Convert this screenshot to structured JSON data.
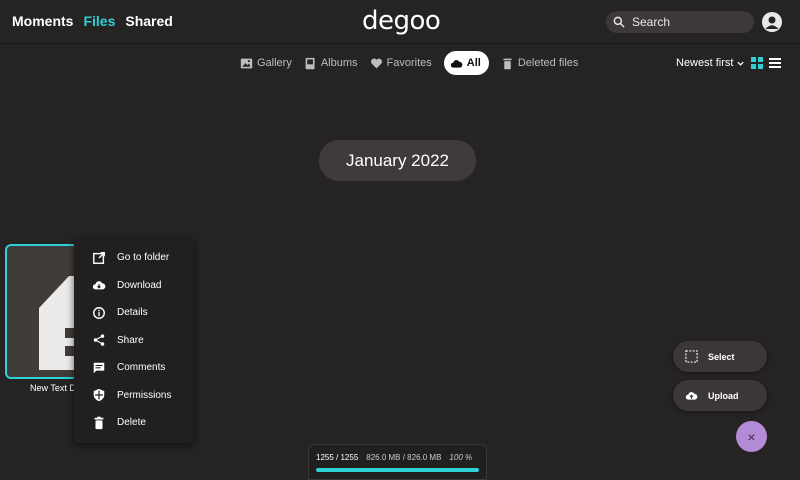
{
  "nav": {
    "moments": "Moments",
    "files": "Files",
    "shared": "Shared",
    "active": "Files"
  },
  "logo": "degoo",
  "search": {
    "label": "Search",
    "icon": "search-icon"
  },
  "filters": [
    {
      "label": "Gallery",
      "icon": "gallery-icon"
    },
    {
      "label": "Albums",
      "icon": "albums-icon"
    },
    {
      "label": "Favorites",
      "icon": "heart-icon"
    },
    {
      "label": "All",
      "icon": "cloud-icon",
      "active": true
    },
    {
      "label": "Deleted files",
      "icon": "trash-icon"
    }
  ],
  "sort": {
    "label": "Newest first"
  },
  "month_label": "January 2022",
  "file": {
    "name": "New Text Do"
  },
  "context_menu": [
    {
      "label": "Go to folder",
      "icon": "open-external-icon"
    },
    {
      "label": "Download",
      "icon": "cloud-download-icon"
    },
    {
      "label": "Details",
      "icon": "info-icon"
    },
    {
      "label": "Share",
      "icon": "share-icon"
    },
    {
      "label": "Comments",
      "icon": "comment-icon"
    },
    {
      "label": "Permissions",
      "icon": "shield-icon"
    },
    {
      "label": "Delete",
      "icon": "trash-icon"
    }
  ],
  "progress": {
    "count": "1255 / 1255",
    "size": "826.0 MB / 826.0 MB",
    "percent": "100 %",
    "fraction": 1.0
  },
  "actions": {
    "select": "Select",
    "upload": "Upload",
    "close": "×"
  },
  "colors": {
    "accent": "#2fd0d6",
    "background": "#262423",
    "fab_close": "#b48bd6"
  }
}
